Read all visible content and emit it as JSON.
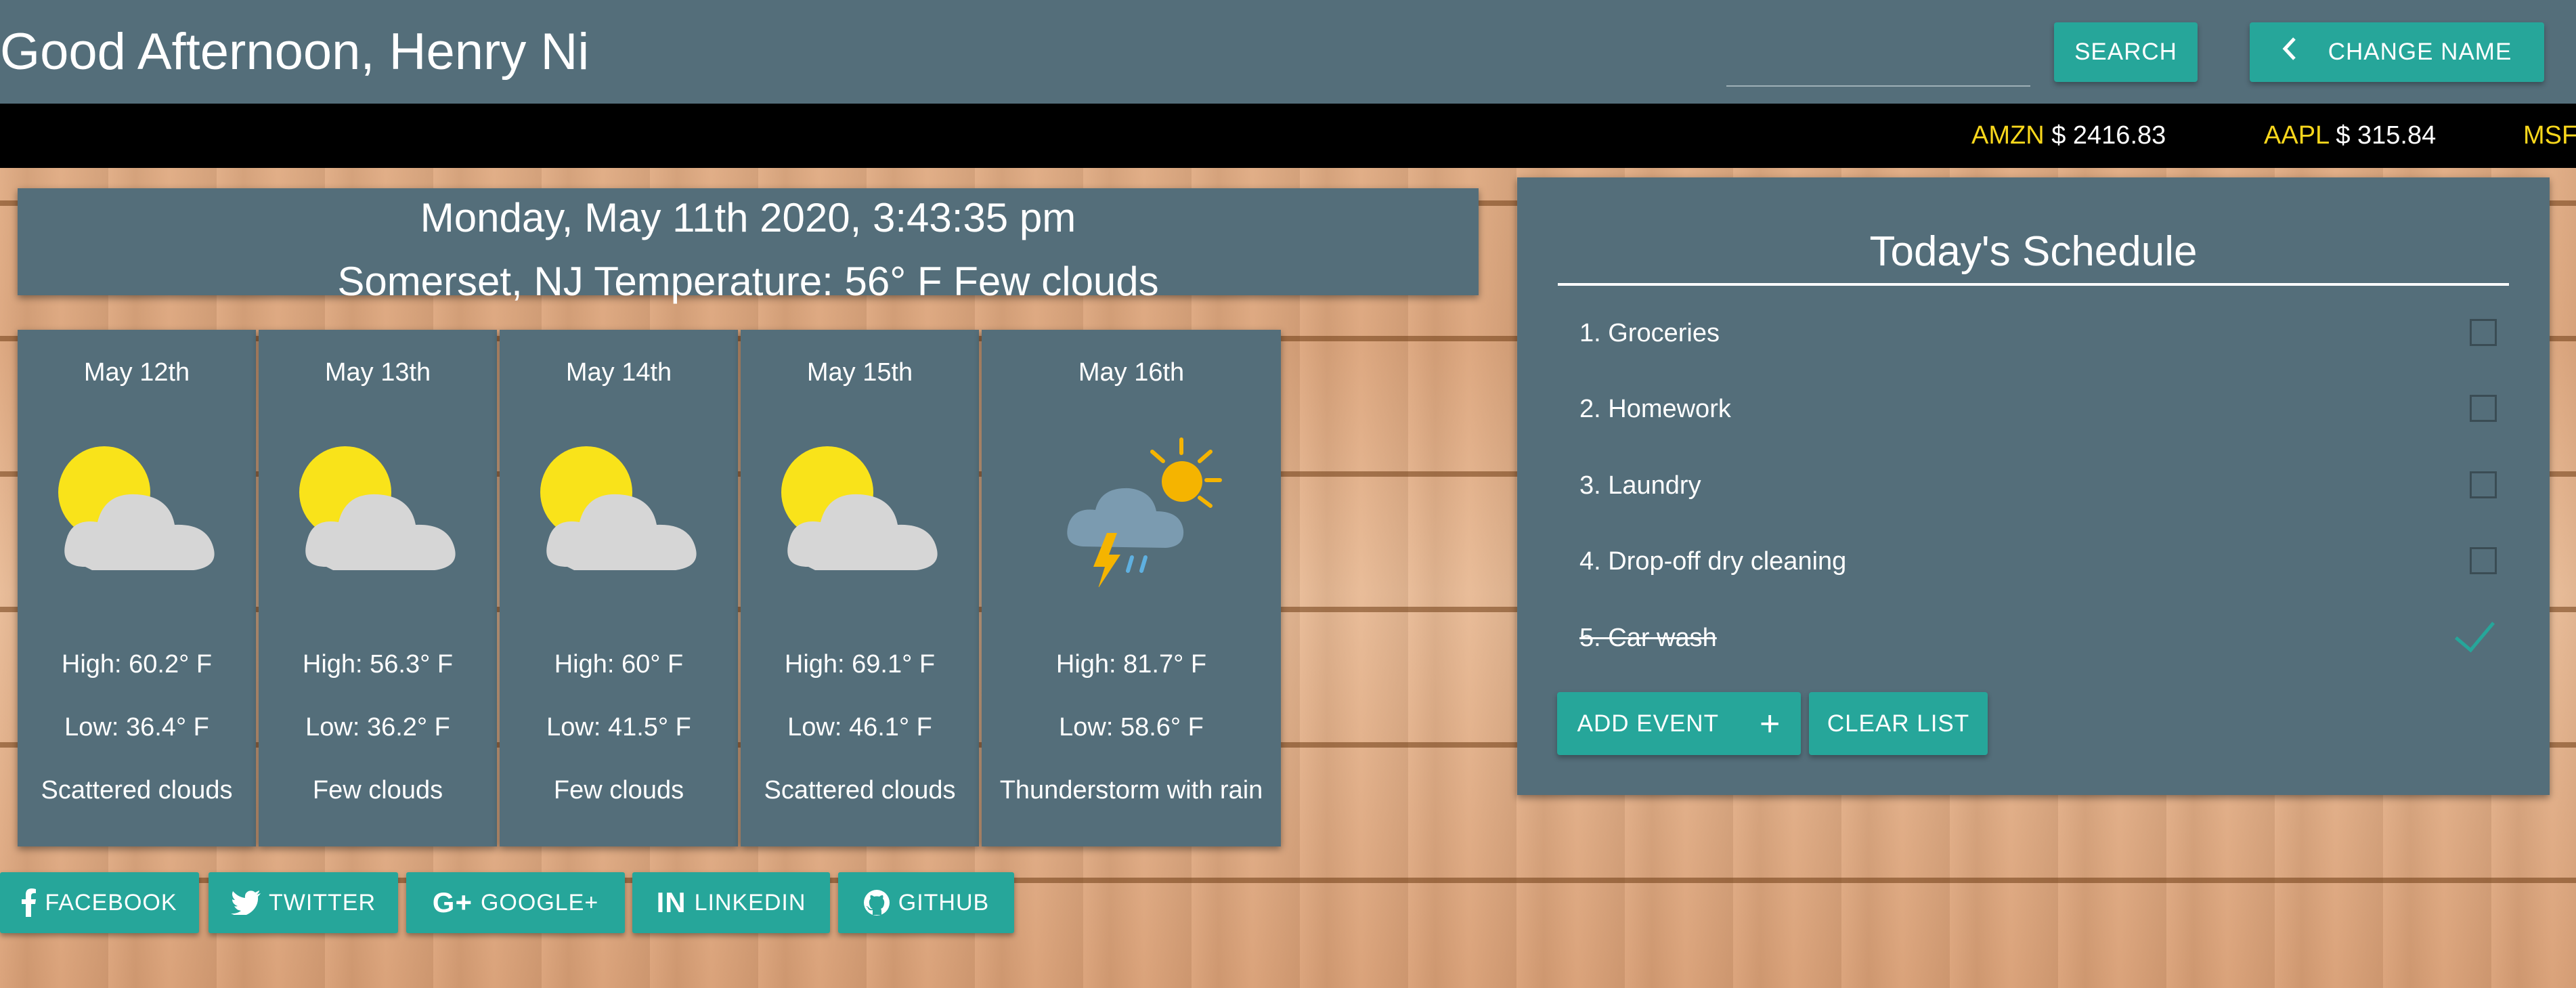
{
  "header": {
    "greeting": "Good Afternoon, Henry Ni",
    "search_placeholder": "",
    "search_label": "SEARCH",
    "change_name_label": "CHANGE NAME"
  },
  "ticker": [
    {
      "symbol": "AMZN",
      "price": "$ 2416.83"
    },
    {
      "symbol": "AAPL",
      "price": "$ 315.84"
    },
    {
      "symbol": "MSFT",
      "price": ""
    }
  ],
  "datetime": {
    "line1": "Monday, May 11th 2020, 3:43:35 pm",
    "line2": "Somerset, NJ Temperature: 56° F Few clouds"
  },
  "forecast": [
    {
      "date": "May 12th",
      "high": "High: 60.2° F",
      "low": "Low: 36.4° F",
      "desc": "Scattered clouds",
      "icon": "partly-cloudy-icon"
    },
    {
      "date": "May 13th",
      "high": "High: 56.3° F",
      "low": "Low: 36.2° F",
      "desc": "Few clouds",
      "icon": "partly-cloudy-icon"
    },
    {
      "date": "May 14th",
      "high": "High: 60° F",
      "low": "Low: 41.5° F",
      "desc": "Few clouds",
      "icon": "partly-cloudy-icon"
    },
    {
      "date": "May 15th",
      "high": "High: 69.1° F",
      "low": "Low: 46.1° F",
      "desc": "Scattered clouds",
      "icon": "partly-cloudy-icon"
    },
    {
      "date": "May 16th",
      "high": "High: 81.7° F",
      "low": "Low: 58.6° F",
      "desc": "Thunderstorm with rain",
      "icon": "thunderstorm-icon"
    }
  ],
  "schedule": {
    "title": "Today's Schedule",
    "items": [
      {
        "label": "1. Groceries",
        "done": false
      },
      {
        "label": "2. Homework",
        "done": false
      },
      {
        "label": "3. Laundry",
        "done": false
      },
      {
        "label": "4. Drop-off dry cleaning",
        "done": false
      },
      {
        "label": "5. Car wash",
        "done": true
      }
    ],
    "add_label": "ADD EVENT",
    "clear_label": "CLEAR LIST"
  },
  "social": [
    {
      "label": "FACEBOOK",
      "icon": "facebook-icon"
    },
    {
      "label": "TWITTER",
      "icon": "twitter-icon"
    },
    {
      "label": "GOOGLE+",
      "icon": "google-plus-icon"
    },
    {
      "label": "LINKEDIN",
      "icon": "linkedin-icon"
    },
    {
      "label": "GITHUB",
      "icon": "github-icon"
    }
  ],
  "colors": {
    "panel": "#546e7a",
    "accent": "#26a69a",
    "ticker_symbol": "#f9d71c"
  }
}
